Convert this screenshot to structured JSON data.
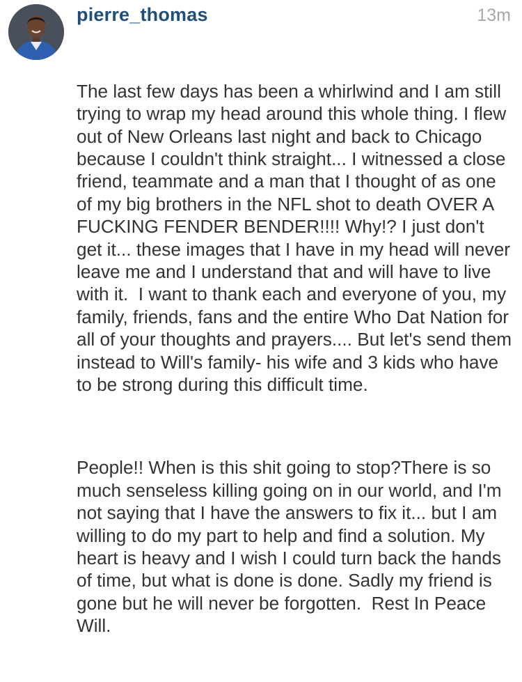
{
  "comment": {
    "username": "pierre_thomas",
    "timestamp": "13m",
    "avatar_icon": "user-avatar-photo",
    "paragraphs": [
      "The last few days has been a whirlwind and I am still trying to wrap my head around this whole thing. I flew out of New Orleans last night and back to Chicago because I couldn't think straight... I witnessed a close friend, teammate and a man that I thought of as one of my big brothers in the NFL shot to death OVER A FUCKING FENDER BENDER!!!! Why!? I just don't get it... these images that I have in my head will never leave me and I understand that and will have to live with it.  I want to thank each and everyone of you, my family, friends, fans and the entire Who Dat Nation for all of your thoughts and prayers.... But let's send them instead to Will's family- his wife and 3 kids who have to be strong during this difficult time.",
      "People!! When is this shit going to stop?There is so much senseless killing going on in our world, and I'm not saying that I have the answers to fix it... but I am willing to do my part to help and find a solution. My heart is heavy and I wish I could turn back the hands of time, but what is done is done. Sadly my friend is gone but he will never be forgotten.  Rest In Peace Will."
    ]
  }
}
